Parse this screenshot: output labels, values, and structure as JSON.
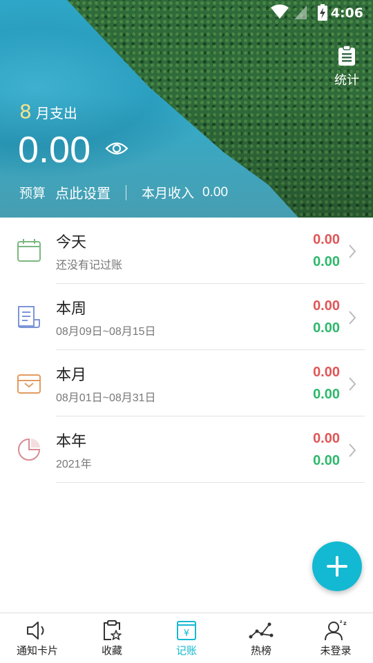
{
  "status_bar": {
    "time": "4:06"
  },
  "header": {
    "stats_label": "统计",
    "month_number": "8",
    "month_suffix": "月支出",
    "monthly_expense": "0.00",
    "budget_label": "预算",
    "budget_setup": "点此设置",
    "income_label": "本月收入",
    "income_value": "0.00"
  },
  "summary_items": [
    {
      "title": "今天",
      "subtitle": "还没有记过账",
      "expense": "0.00",
      "income": "0.00",
      "icon": "calendar-icon",
      "color": "#7bb77e"
    },
    {
      "title": "本周",
      "subtitle": "08月09日~08月15日",
      "expense": "0.00",
      "income": "0.00",
      "icon": "receipt-icon",
      "color": "#7c95d8"
    },
    {
      "title": "本月",
      "subtitle": "08月01日~08月31日",
      "expense": "0.00",
      "income": "0.00",
      "icon": "wallet-icon",
      "color": "#e39a5e"
    },
    {
      "title": "本年",
      "subtitle": "2021年",
      "expense": "0.00",
      "income": "0.00",
      "icon": "pie-chart-icon",
      "color": "#d88a93"
    }
  ],
  "colors": {
    "accent": "#13b9d2",
    "expense": "#e05656",
    "income": "#2db86b"
  },
  "bottom_nav": [
    {
      "label": "通知卡片",
      "icon": "speaker-icon",
      "active": false
    },
    {
      "label": "收藏",
      "icon": "clipboard-star-icon",
      "active": false
    },
    {
      "label": "记账",
      "icon": "ledger-yen-icon",
      "active": true
    },
    {
      "label": "热榜",
      "icon": "trend-icon",
      "active": false
    },
    {
      "label": "未登录",
      "icon": "user-sleep-icon",
      "active": false
    }
  ]
}
